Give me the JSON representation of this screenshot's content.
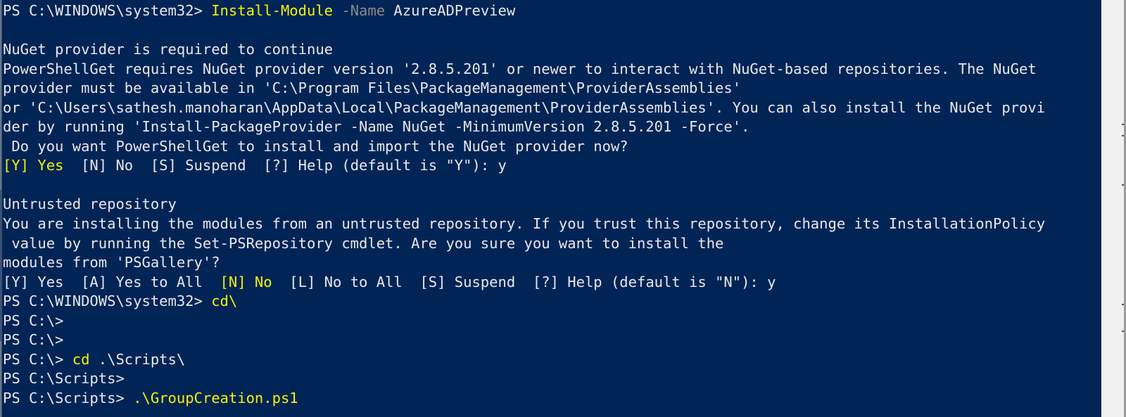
{
  "window": {
    "kind": "powershell-console",
    "background_color": "#012456",
    "default_text_color": "#cccccc",
    "command_color": "#f2f20a",
    "parameter_color": "#808080",
    "scrollbar_track_color": "#f0f0f0"
  },
  "prompts": {
    "system32": "PS C:\\WINDOWS\\system32> ",
    "c_root": "PS C:\\>",
    "c_root_cmd": "PS C:\\> ",
    "scripts": "PS C:\\Scripts>",
    "scripts_cmd": "PS C:\\Scripts> "
  },
  "lines": [
    {
      "id": "line-install-module",
      "segments": [
        {
          "text": "PS C:\\WINDOWS\\system32> ",
          "color": "white"
        },
        {
          "text": "Install-Module",
          "color": "yellow"
        },
        {
          "text": " ",
          "color": "white"
        },
        {
          "text": "-Name",
          "color": "gray"
        },
        {
          "text": " AzureADPreview",
          "color": "white"
        }
      ]
    },
    {
      "id": "line-blank-1",
      "segments": [
        {
          "text": "",
          "color": "white"
        }
      ]
    },
    {
      "id": "line-nuget-required",
      "segments": [
        {
          "text": "NuGet provider is required to continue",
          "color": "white"
        }
      ]
    },
    {
      "id": "line-psget-requires",
      "segments": [
        {
          "text": "PowerShellGet requires NuGet provider version '2.8.5.201' or newer to interact with NuGet-based repositories. The NuGet",
          "color": "white"
        }
      ]
    },
    {
      "id": "line-provider-path-1",
      "segments": [
        {
          "text": "provider must be available in 'C:\\Program Files\\PackageManagement\\ProviderAssemblies'",
          "color": "white"
        }
      ]
    },
    {
      "id": "line-provider-path-2",
      "segments": [
        {
          "text": "or 'C:\\Users\\sathesh.manoharan\\AppData\\Local\\PackageManagement\\ProviderAssemblies'. You can also install the NuGet provi",
          "color": "white"
        }
      ]
    },
    {
      "id": "line-provider-path-3",
      "segments": [
        {
          "text": "der by running 'Install-PackageProvider -Name NuGet -MinimumVersion 2.8.5.201 -Force'.",
          "color": "white"
        }
      ]
    },
    {
      "id": "line-do-you-want",
      "segments": [
        {
          "text": " Do you want PowerShellGet to install and import the NuGet provider now?",
          "color": "white"
        }
      ]
    },
    {
      "id": "line-prompt-nuget",
      "segments": [
        {
          "text": "[Y] Yes",
          "color": "yellow"
        },
        {
          "text": "  [N] No  [S] Suspend  [?] Help (default is \"Y\"): y",
          "color": "white"
        }
      ]
    },
    {
      "id": "line-blank-2",
      "segments": [
        {
          "text": "",
          "color": "white"
        }
      ]
    },
    {
      "id": "line-untrusted-repo-title",
      "segments": [
        {
          "text": "Untrusted repository",
          "color": "white"
        }
      ]
    },
    {
      "id": "line-untrusted-body-1",
      "segments": [
        {
          "text": "You are installing the modules from an untrusted repository. If you trust this repository, change its InstallationPolicy",
          "color": "white"
        }
      ]
    },
    {
      "id": "line-untrusted-body-2",
      "segments": [
        {
          "text": " value by running the Set-PSRepository cmdlet. Are you sure you want to install the",
          "color": "white"
        }
      ]
    },
    {
      "id": "line-untrusted-body-3",
      "segments": [
        {
          "text": "modules from 'PSGallery'?",
          "color": "white"
        }
      ]
    },
    {
      "id": "line-prompt-untrusted",
      "segments": [
        {
          "text": "[Y] Yes  [A] Yes to All  ",
          "color": "white"
        },
        {
          "text": "[N] No",
          "color": "yellow"
        },
        {
          "text": "  [L] No to All  [S] Suspend  [?] Help (default is \"N\"): y",
          "color": "white"
        }
      ]
    },
    {
      "id": "line-cd-root",
      "segments": [
        {
          "text": "PS C:\\WINDOWS\\system32> ",
          "color": "white"
        },
        {
          "text": "cd\\",
          "color": "yellow"
        }
      ]
    },
    {
      "id": "line-prompt-c-1",
      "segments": [
        {
          "text": "PS C:\\>",
          "color": "white"
        }
      ]
    },
    {
      "id": "line-prompt-c-2",
      "segments": [
        {
          "text": "PS C:\\>",
          "color": "white"
        }
      ]
    },
    {
      "id": "line-cd-scripts",
      "segments": [
        {
          "text": "PS C:\\> ",
          "color": "white"
        },
        {
          "text": "cd",
          "color": "yellow"
        },
        {
          "text": " .\\Scripts\\",
          "color": "white"
        }
      ]
    },
    {
      "id": "line-prompt-scripts-1",
      "segments": [
        {
          "text": "PS C:\\Scripts>",
          "color": "white"
        }
      ]
    },
    {
      "id": "line-run-script",
      "segments": [
        {
          "text": "PS C:\\Scripts> ",
          "color": "white"
        },
        {
          "text": ".\\GroupCreation.ps1",
          "color": "yellow"
        }
      ]
    }
  ]
}
